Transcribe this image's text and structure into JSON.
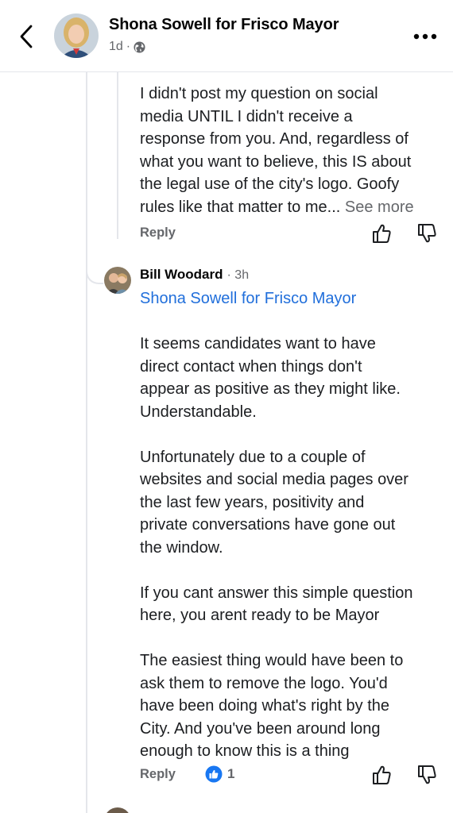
{
  "header": {
    "page_name": "Shona Sowell for Frisco Mayor",
    "time": "1d",
    "separator": "·",
    "back_icon": "chevron-left-icon",
    "privacy_icon": "globe-icon",
    "more_icon": "ellipsis-icon"
  },
  "comment1": {
    "lines": [
      "I didn't post my question on social",
      "media UNTIL I didn't receive a",
      "response from you. And, regardless of",
      "what you want to believe, this IS about",
      "the legal use of the city's logo. Goofy"
    ],
    "last_line": "rules like that matter to me...",
    "see_more": "See more",
    "reply": "Reply"
  },
  "comment2": {
    "author": "Bill Woodard",
    "time": "· 3h",
    "mention": "Shona Sowell for Frisco Mayor",
    "paragraphs": [
      [
        "It seems candidates want to have",
        "direct contact when things don't",
        "appear as positive as they might like.",
        "Understandable."
      ],
      [
        "Unfortunately due to a couple of",
        "websites and social media pages over",
        "the last few years, positivity and",
        "private conversations have gone out",
        "the window."
      ],
      [
        "If you cant answer this simple question",
        "here, you arent ready to be Mayor"
      ],
      [
        "The easiest thing would have been to",
        "ask them to remove the logo.  You'd",
        "have been doing what's right by the",
        "City.  And you've been around long",
        "enough to know this is a thing"
      ]
    ],
    "reply": "Reply",
    "reaction_icon": "like-reaction-icon",
    "reaction_count": "1"
  },
  "colors": {
    "link_blue": "#216fdb",
    "reaction_blue": "#1877f2",
    "meta_gray": "#65676b"
  }
}
